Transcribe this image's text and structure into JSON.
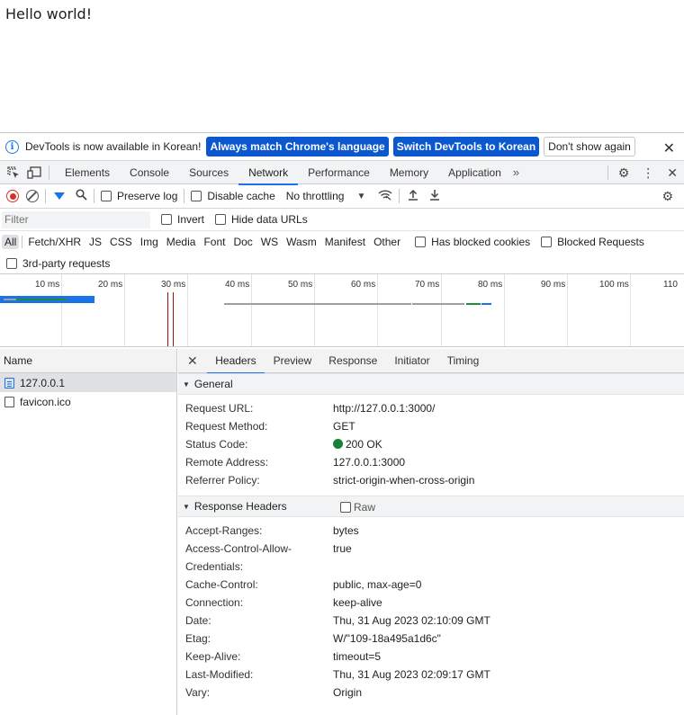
{
  "page": {
    "text": "Hello world!"
  },
  "infobar": {
    "message": "DevTools is now available in Korean!",
    "btn_match": "Always match Chrome's language",
    "btn_switch": "Switch DevTools to Korean",
    "btn_dismiss": "Don't show again"
  },
  "tabs": [
    "Elements",
    "Console",
    "Sources",
    "Network",
    "Performance",
    "Memory",
    "Application"
  ],
  "active_tab": "Network",
  "toolbar": {
    "preserve_log": "Preserve log",
    "disable_cache": "Disable cache",
    "throttling": "No throttling"
  },
  "filter": {
    "placeholder": "Filter",
    "invert": "Invert",
    "hide_data_urls": "Hide data URLs"
  },
  "types": [
    "All",
    "Fetch/XHR",
    "JS",
    "CSS",
    "Img",
    "Media",
    "Font",
    "Doc",
    "WS",
    "Wasm",
    "Manifest",
    "Other"
  ],
  "type_extra": {
    "blocked_cookies": "Has blocked cookies",
    "blocked_requests": "Blocked Requests",
    "third_party": "3rd-party requests"
  },
  "timeline": {
    "ticks": [
      "10 ms",
      "20 ms",
      "30 ms",
      "40 ms",
      "50 ms",
      "60 ms",
      "70 ms",
      "80 ms",
      "90 ms",
      "100 ms",
      "110"
    ]
  },
  "requests": {
    "header": "Name",
    "items": [
      "127.0.0.1",
      "favicon.ico"
    ]
  },
  "details": {
    "tabs": [
      "Headers",
      "Preview",
      "Response",
      "Initiator",
      "Timing"
    ],
    "active_tab": "Headers",
    "general_title": "General",
    "general": [
      {
        "k": "Request URL:",
        "v": "http://127.0.0.1:3000/"
      },
      {
        "k": "Request Method:",
        "v": "GET"
      },
      {
        "k": "Status Code:",
        "v": "200 OK"
      },
      {
        "k": "Remote Address:",
        "v": "127.0.0.1:3000"
      },
      {
        "k": "Referrer Policy:",
        "v": "strict-origin-when-cross-origin"
      }
    ],
    "response_title": "Response Headers",
    "raw_label": "Raw",
    "response": [
      {
        "k": "Accept-Ranges:",
        "v": "bytes"
      },
      {
        "k": "Access-Control-Allow-",
        "v": "true"
      },
      {
        "k": "Credentials:",
        "v": ""
      },
      {
        "k": "Cache-Control:",
        "v": "public, max-age=0"
      },
      {
        "k": "Connection:",
        "v": "keep-alive"
      },
      {
        "k": "Date:",
        "v": "Thu, 31 Aug 2023 02:10:09 GMT"
      },
      {
        "k": "Etag:",
        "v": "W/\"109-18a495a1d6c\""
      },
      {
        "k": "Keep-Alive:",
        "v": "timeout=5"
      },
      {
        "k": "Last-Modified:",
        "v": "Thu, 31 Aug 2023 02:09:17 GMT"
      },
      {
        "k": "Vary:",
        "v": "Origin"
      }
    ]
  },
  "colors": {
    "accent": "#1a73e8",
    "status_ok": "#188038",
    "record": "#d93025"
  }
}
